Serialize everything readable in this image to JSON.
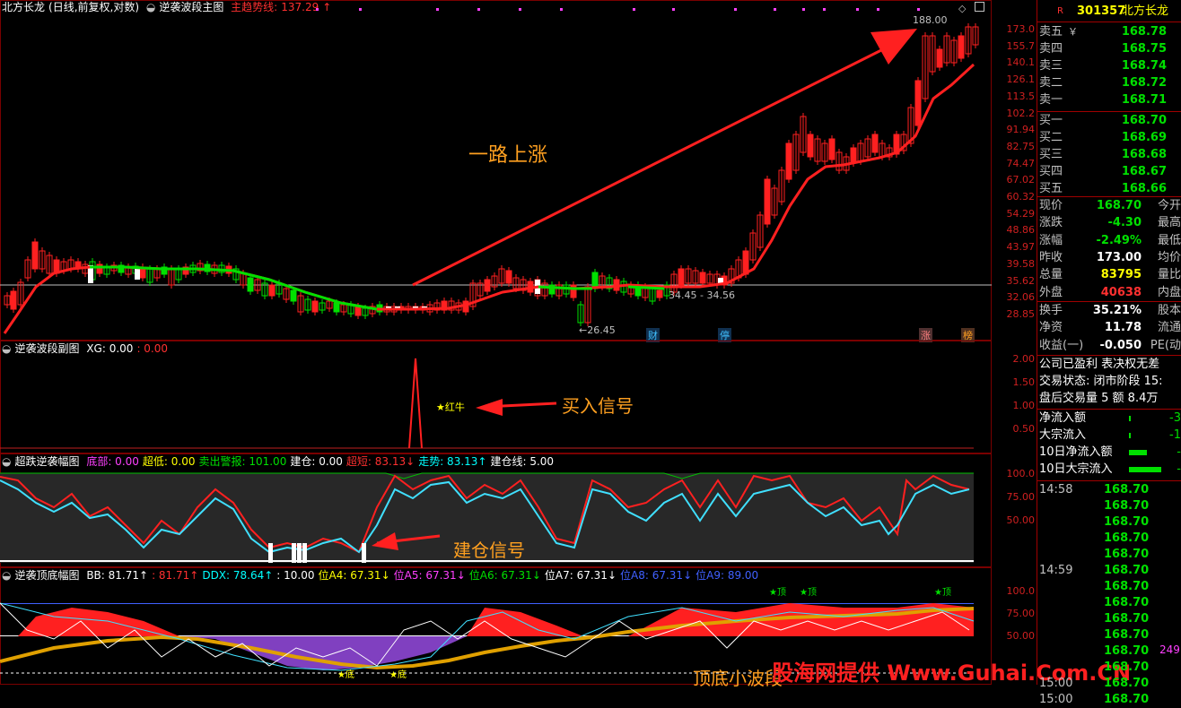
{
  "main_panel": {
    "title": "北方长龙",
    "mode": "(日线,前复权,对数)",
    "indicator_name": "逆袭波段主图",
    "trend_label": "主趋势线:",
    "trend_value": "137.29",
    "arrow_up": "↑",
    "annotation_rise": "一路上涨",
    "label_high": "188.00",
    "label_low": "26.45",
    "label_range": "34.45 - 34.56",
    "marker_cai": "财",
    "marker_ting": "停",
    "marker_zhang": "涨",
    "marker_bang": "榜",
    "axis_ticks": [
      "173.0",
      "155.7",
      "140.1",
      "126.1",
      "113.5",
      "102.2",
      "91.94",
      "82.75",
      "74.47",
      "67.02",
      "60.32",
      "54.29",
      "48.86",
      "43.97",
      "39.58",
      "35.62",
      "32.06",
      "28.85"
    ],
    "r_mark": "R"
  },
  "panel2": {
    "indicator_name": "逆袭波段副图",
    "xg_label": "XG: 0.00",
    "xg_value": ": 0.00",
    "hongniu_label": "★红牛",
    "annotation_buy": "买入信号",
    "axis_ticks": [
      "2.00",
      "1.50",
      "1.00",
      "0.50"
    ]
  },
  "panel3": {
    "indicator_name": "超跌逆袭幅图",
    "items": [
      {
        "label": "底部: 0.00",
        "color": "#ff40ff"
      },
      {
        "label": "超低: 0.00",
        "color": "#ffff00"
      },
      {
        "label": "卖出警报: 101.00",
        "color": "#00e000"
      },
      {
        "label": "建仓: 0.00",
        "color": "#ffffff"
      },
      {
        "label": "超短: 83.13↓",
        "color": "#ff3030"
      },
      {
        "label": "走势: 83.13↑",
        "color": "#00ffff"
      },
      {
        "label": "建仓线: 5.00",
        "color": "#ffffff"
      }
    ],
    "annotation_build": "建仓信号",
    "axis_ticks": [
      "100.0",
      "75.00",
      "50.00"
    ]
  },
  "panel4": {
    "indicator_name": "逆袭顶底幅图",
    "items": [
      {
        "label": "BB: 81.71↑",
        "color": "#ffffff"
      },
      {
        "label": ": 81.71↑",
        "color": "#ff3030"
      },
      {
        "label": "DDX: 78.64↑",
        "color": "#00ffff"
      },
      {
        "label": ": 10.00",
        "color": "#ffffff"
      },
      {
        "label": "位A4: 67.31↓",
        "color": "#ffff00"
      },
      {
        "label": "位A5: 67.31↓",
        "color": "#ff40ff"
      },
      {
        "label": "位A6: 67.31↓",
        "color": "#00e000"
      },
      {
        "label": "位A7: 67.31↓",
        "color": "#ffffff"
      },
      {
        "label": "位A8: 67.31↓",
        "color": "#4060ff"
      },
      {
        "label": "位A9: 89.00",
        "color": "#4060ff"
      }
    ],
    "annotation_bottom": "顶底小波段",
    "ding": "★顶",
    "di": "★底",
    "axis_ticks": [
      "100.0",
      "75.00",
      "50.00"
    ]
  },
  "watermark": "股海网提供 Www.Guhai.Com.CN",
  "sidebar": {
    "code": "301357",
    "name": "北方长龙",
    "sell": [
      {
        "label": "卖五",
        "price": "168.78"
      },
      {
        "label": "卖四",
        "price": "168.75"
      },
      {
        "label": "卖三",
        "price": "168.74"
      },
      {
        "label": "卖二",
        "price": "168.72"
      },
      {
        "label": "卖一",
        "price": "168.71"
      }
    ],
    "buy": [
      {
        "label": "买一",
        "price": "168.70"
      },
      {
        "label": "买二",
        "price": "168.69"
      },
      {
        "label": "买三",
        "price": "168.68"
      },
      {
        "label": "买四",
        "price": "168.67"
      },
      {
        "label": "买五",
        "price": "168.66"
      }
    ],
    "yen": "￥",
    "stats": [
      {
        "k": "现价",
        "v": "168.70",
        "k2": "今开",
        "vc": "#00e000"
      },
      {
        "k": "涨跌",
        "v": "-4.30",
        "k2": "最高",
        "vc": "#00e000"
      },
      {
        "k": "涨幅",
        "v": "-2.49%",
        "k2": "最低",
        "vc": "#00e000"
      },
      {
        "k": "昨收",
        "v": "173.00",
        "k2": "均价",
        "vc": "#ffffff"
      },
      {
        "k": "总量",
        "v": "83795",
        "k2": "量比",
        "vc": "#ffff00"
      },
      {
        "k": "外盘",
        "v": "40638",
        "k2": "内盘",
        "vc": "#ff3030"
      }
    ],
    "stats2": [
      {
        "k": "换手",
        "v": "35.21%",
        "k2": "股本",
        "vc": "#ffffff"
      },
      {
        "k": "净资",
        "v": "11.78",
        "k2": "流通",
        "vc": "#ffffff"
      },
      {
        "k": "收益(一)",
        "v": "-0.050",
        "k2": "PE(动",
        "vc": "#ffffff"
      }
    ],
    "info1": "公司已盈利 表决权无差",
    "info2": "交易状态: 闭市阶段 15:",
    "info3": "盘后交易量 5 额 8.4万",
    "flows": [
      {
        "k": "净流入额",
        "v": "-3"
      },
      {
        "k": "大宗流入",
        "v": "-1"
      },
      {
        "k": "10日净流入额",
        "v": "-"
      },
      {
        "k": "10日大宗流入",
        "v": "-"
      }
    ],
    "ticks": [
      {
        "t": "14:58",
        "p": "168.70"
      },
      {
        "t": "",
        "p": "168.70"
      },
      {
        "t": "",
        "p": "168.70"
      },
      {
        "t": "",
        "p": "168.70"
      },
      {
        "t": "",
        "p": "168.70"
      },
      {
        "t": "14:59",
        "p": "168.70"
      },
      {
        "t": "",
        "p": "168.70"
      },
      {
        "t": "",
        "p": "168.70"
      },
      {
        "t": "",
        "p": "168.70"
      },
      {
        "t": "",
        "p": "168.70"
      },
      {
        "t": "",
        "p": "168.70"
      },
      {
        "t": "",
        "p": "168.70"
      },
      {
        "t": "15:00",
        "p": "168.70"
      },
      {
        "t": "15:00",
        "p": "168.70"
      }
    ],
    "tick_extra": "249"
  }
}
